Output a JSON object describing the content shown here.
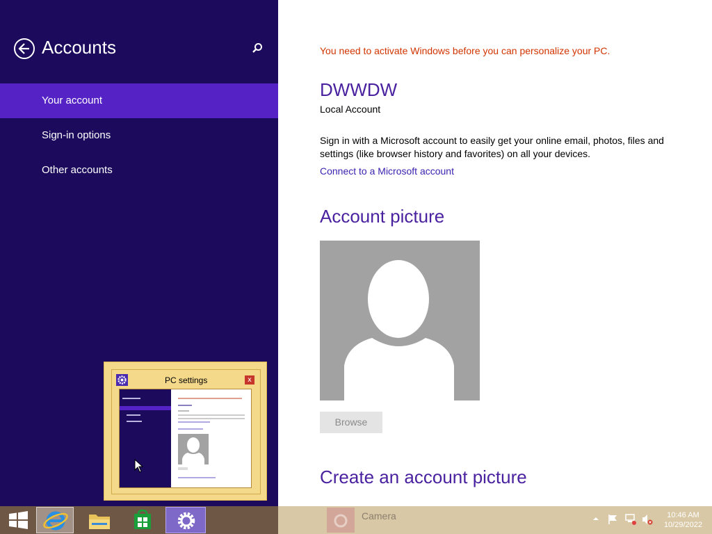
{
  "left_pane": {
    "title": "Accounts",
    "nav": [
      {
        "label": "Your account",
        "selected": true
      },
      {
        "label": "Sign-in options",
        "selected": false
      },
      {
        "label": "Other accounts",
        "selected": false
      }
    ]
  },
  "main": {
    "activation_notice": "You need to activate Windows before you can personalize your PC.",
    "username": "DWWDW",
    "account_type": "Local Account",
    "description": "Sign in with a Microsoft account to easily get your online email, photos, files and settings (like browser history and favorites) on all your devices.",
    "connect_link": "Connect to a Microsoft account",
    "account_picture_heading": "Account picture",
    "browse_label": "Browse",
    "create_picture_heading": "Create an account picture"
  },
  "thumbnail": {
    "title": "PC settings",
    "close_glyph": "x"
  },
  "taskbar": {
    "apps": [
      {
        "name": "start",
        "icon": "windows-logo-icon"
      },
      {
        "name": "internet-explorer",
        "icon": "ie-icon"
      },
      {
        "name": "file-explorer",
        "icon": "folder-icon"
      },
      {
        "name": "store",
        "icon": "store-icon"
      },
      {
        "name": "pc-settings",
        "icon": "gear-icon"
      }
    ],
    "camera_label": "Camera",
    "time": "10:46 AM",
    "date": "10/29/2022"
  },
  "colors": {
    "left_pane_bg": "#1c0a5c",
    "selected_nav": "#5522c5",
    "accent_heading": "#4a22a0",
    "warning": "#d13400"
  }
}
